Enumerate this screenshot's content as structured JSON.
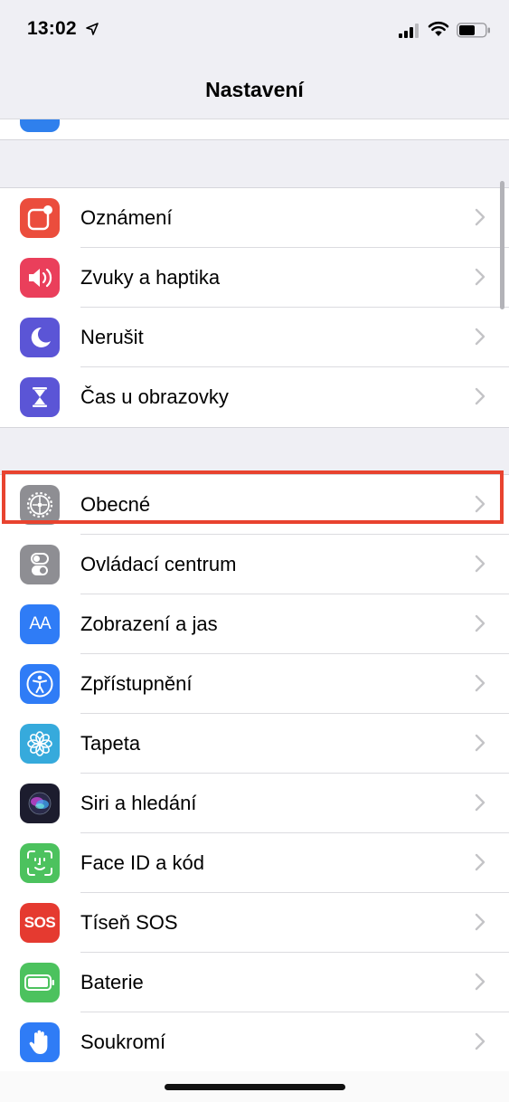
{
  "status": {
    "time": "13:02",
    "signal_icon": "cellular-signal-icon",
    "wifi_icon": "wifi-icon",
    "battery_icon": "battery-icon"
  },
  "nav": {
    "title": "Nastavení"
  },
  "groups": [
    {
      "items": [
        {
          "key": "notifications",
          "label": "Oznámení",
          "icon": "notifications-icon",
          "color": "#eb4d3d"
        },
        {
          "key": "sounds",
          "label": "Zvuky a haptika",
          "icon": "speaker-icon",
          "color": "#ea3f5b"
        },
        {
          "key": "dnd",
          "label": "Nerušit",
          "icon": "moon-icon",
          "color": "#5b55d6"
        },
        {
          "key": "screentime",
          "label": "Čas u obrazovky",
          "icon": "hourglass-icon",
          "color": "#5b55d6"
        }
      ]
    },
    {
      "items": [
        {
          "key": "general",
          "label": "Obecné",
          "icon": "gear-icon",
          "color": "#8e8e93",
          "highlighted": true
        },
        {
          "key": "control",
          "label": "Ovládací centrum",
          "icon": "toggles-icon",
          "color": "#8e8e93"
        },
        {
          "key": "display",
          "label": "Zobrazení a jas",
          "icon": "text-size-icon",
          "color": "#2f7cf6",
          "icon_text": "AA"
        },
        {
          "key": "accessibility",
          "label": "Zpřístupnění",
          "icon": "accessibility-icon",
          "color": "#2f7cf6"
        },
        {
          "key": "wallpaper",
          "label": "Tapeta",
          "icon": "flower-icon",
          "color": "#36aadc"
        },
        {
          "key": "siri",
          "label": "Siri a hledání",
          "icon": "siri-icon",
          "color": "#1c1c2e"
        },
        {
          "key": "faceid",
          "label": "Face ID a kód",
          "icon": "face-id-icon",
          "color": "#4cc25e"
        },
        {
          "key": "sos",
          "label": "Tíseň SOS",
          "icon": "sos-icon",
          "color": "#e53a30",
          "icon_text": "SOS"
        },
        {
          "key": "battery",
          "label": "Baterie",
          "icon": "battery-setting-icon",
          "color": "#4cc25e"
        },
        {
          "key": "privacy",
          "label": "Soukromí",
          "icon": "hand-icon",
          "color": "#2f7cf6"
        }
      ]
    }
  ]
}
